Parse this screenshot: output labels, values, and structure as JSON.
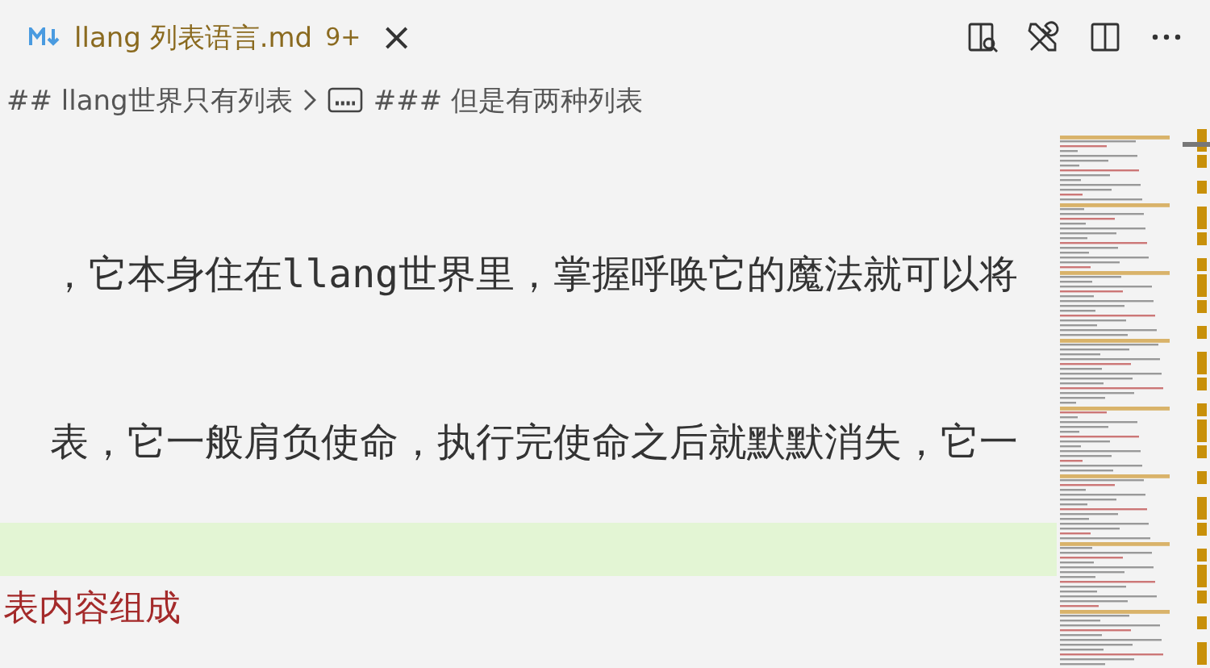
{
  "tab": {
    "title": "llang 列表语言.md",
    "badge": "9+",
    "close": "×"
  },
  "toolbar": [
    {
      "kind": "preview"
    },
    {
      "kind": "tools"
    },
    {
      "kind": "split"
    },
    {
      "kind": "more"
    }
  ],
  "breadcrumb": [
    {
      "kind": "heading",
      "label": "## llang世界只有列表"
    },
    {
      "kind": "string",
      "label": "### 但是有两种列表"
    }
  ],
  "lines": [
    {
      "kind": "text",
      "text": "，它本身住在llang世界里，掌握呼唤它的魔法就可以将"
    },
    {
      "kind": "blank"
    },
    {
      "kind": "text",
      "text": "表，它一般肩负使命，执行完使命之后就默默消失，它一"
    },
    {
      "kind": "highlight"
    },
    {
      "kind": "heading",
      "text": "表内容组成"
    }
  ]
}
